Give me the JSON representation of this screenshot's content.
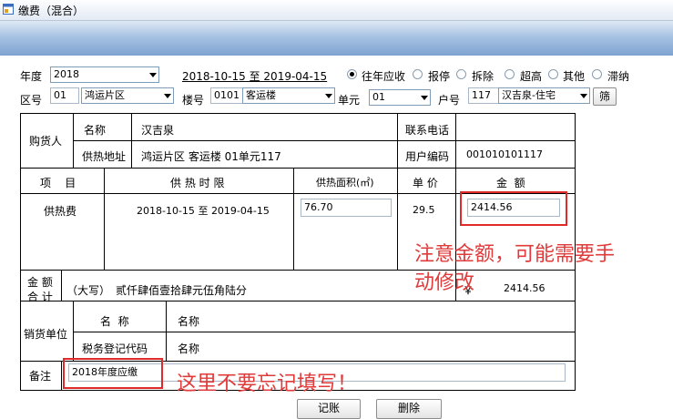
{
  "window": {
    "title": "缴费（混合）"
  },
  "filters": {
    "year_label": "年度",
    "year_value": "2018",
    "period_from": "2018-10-15",
    "period_to_word": "至",
    "period_to": "2019-04-15",
    "radios": [
      {
        "label": "往年应收",
        "selected": true
      },
      {
        "label": "报停",
        "selected": false
      },
      {
        "label": "拆除",
        "selected": false
      },
      {
        "label": "超高",
        "selected": false
      },
      {
        "label": "其他",
        "selected": false
      },
      {
        "label": "滞纳",
        "selected": false
      }
    ],
    "district_label": "区号",
    "district_code": "01",
    "district_name": "鸿运片区",
    "building_label": "楼号",
    "building_code": "0101",
    "building_name": "客运楼",
    "unit_label": "单元",
    "unit_value": "01",
    "household_label": "户号",
    "household_code": "117",
    "household_name": "汉吉泉-住宅",
    "filter_button": "筛"
  },
  "buyer": {
    "section_label": "购货人",
    "name_label": "名称",
    "name_value": "汉吉泉",
    "phone_label": "联系电话",
    "phone_value": "",
    "address_label": "供热地址",
    "address_value": "鸿运片区 客运楼 01单元117",
    "code_label": "用户编码",
    "code_value": "001010101117"
  },
  "items_table": {
    "headers": {
      "item": "项    目",
      "period": "供 热 时 限",
      "area": "供热面积(㎡)",
      "price": "单 价",
      "amount": "金  额"
    },
    "row": {
      "item": "供热费",
      "period_from": "2018-10-15",
      "period_to_word": "至",
      "period_to": "2019-04-15",
      "area": "76.70",
      "price": "29.5",
      "amount": "2414.56"
    }
  },
  "total": {
    "label_line1": "金 额",
    "label_line2": "合 计",
    "uppercase_prefix": "（大写）",
    "uppercase_value": "贰仟肆佰壹拾肆元伍角陆分",
    "currency_symbol": "￥",
    "amount": "2414.56"
  },
  "seller": {
    "section_label": "销货单位",
    "name_label": "名  称",
    "name_value": "名称",
    "tax_label": "税务登记代码",
    "tax_value": "名称"
  },
  "remark": {
    "label": "备注",
    "value": "2018年度应缴"
  },
  "annotations": {
    "amount_note_line1": "注意金额，可能需要手",
    "amount_note_line2": "动修改",
    "remark_note": "这里不要忘记填写！"
  },
  "bottom_buttons": [
    "记账",
    "删除"
  ],
  "colors": {
    "annotation_red": "#e03a3a",
    "banner_blue": "#7ea3d1"
  }
}
